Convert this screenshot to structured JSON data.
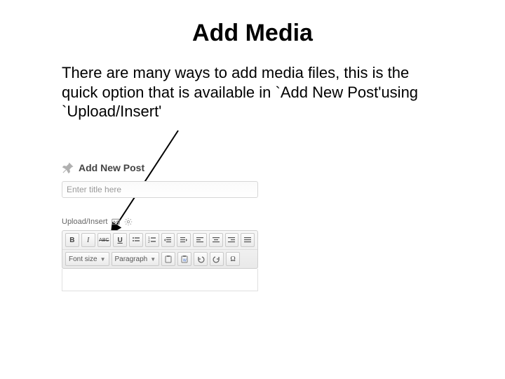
{
  "slide": {
    "title": "Add Media",
    "body": "There are many ways to add media files, this is the quick option that is available  in `Add New Post'using `Upload/Insert'"
  },
  "wp": {
    "header": "Add New Post",
    "title_placeholder": "Enter title here",
    "upload_label": "Upload/Insert",
    "media_btn_title": "Add Media",
    "toolbar": {
      "bold": "B",
      "italic": "I",
      "strike": "ABC",
      "underline": "U",
      "font_size_label": "Font size",
      "paragraph_label": "Paragraph",
      "omega": "Ω"
    }
  }
}
